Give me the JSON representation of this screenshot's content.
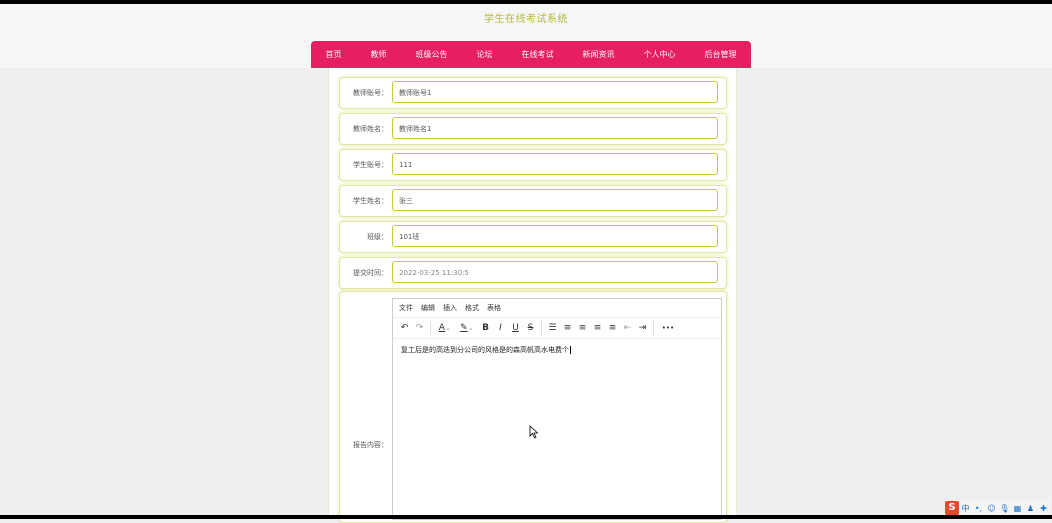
{
  "header": {
    "title": "学生在线考试系统"
  },
  "nav": {
    "items": [
      {
        "label": "首页"
      },
      {
        "label": "教师"
      },
      {
        "label": "班级公告"
      },
      {
        "label": "论坛"
      },
      {
        "label": "在线考试"
      },
      {
        "label": "新闻资讯"
      },
      {
        "label": "个人中心"
      },
      {
        "label": "后台管理"
      }
    ]
  },
  "form": {
    "fields": [
      {
        "label": "教师账号：",
        "value": "教师账号1"
      },
      {
        "label": "教师姓名：",
        "value": "教师姓名1"
      },
      {
        "label": "学生账号：",
        "value": "111"
      },
      {
        "label": "学生姓名：",
        "value": "张三"
      },
      {
        "label": "班级：",
        "value": "101班"
      },
      {
        "label": "提交时间：",
        "value": "2022-03-25 11:30:5"
      }
    ],
    "editor": {
      "label": "报告内容：",
      "menu": [
        "文件",
        "编辑",
        "插入",
        "格式",
        "表格"
      ],
      "toolbar_icons": {
        "undo": "↶",
        "redo": "↷",
        "text_color": "A",
        "highlight": "✎",
        "bold": "B",
        "italic": "I",
        "underline": "U",
        "strikethrough": "S",
        "list": "☰",
        "align_left": "≡",
        "align_center": "≡",
        "align_right": "≡",
        "justify": "≡",
        "outdent": "⇤",
        "indent": "⇥",
        "more": "•••"
      },
      "content": "复工后是的高迭到分公司的风格是的森高帆高水电费个"
    }
  },
  "tray": {
    "logo": "S",
    "ime": "中"
  },
  "colors": {
    "nav_bg": "#e61e63",
    "title": "#b8b83a",
    "field_border": "#c8c83a"
  }
}
